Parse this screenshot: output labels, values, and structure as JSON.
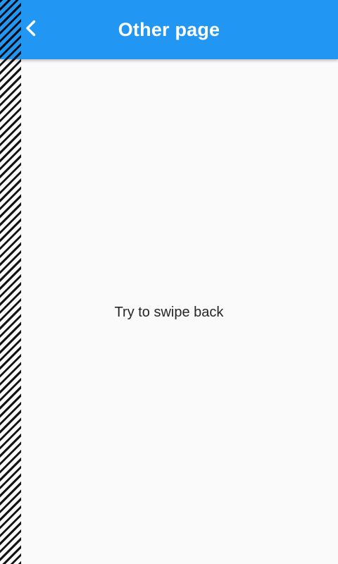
{
  "app_bar": {
    "title": "Other page",
    "background_color": "#2196f3",
    "back_icon": "chevron-left-icon"
  },
  "content": {
    "message": "Try to swipe back"
  },
  "colors": {
    "background": "#fafafa",
    "text": "#262626",
    "title_text": "#ffffff"
  }
}
